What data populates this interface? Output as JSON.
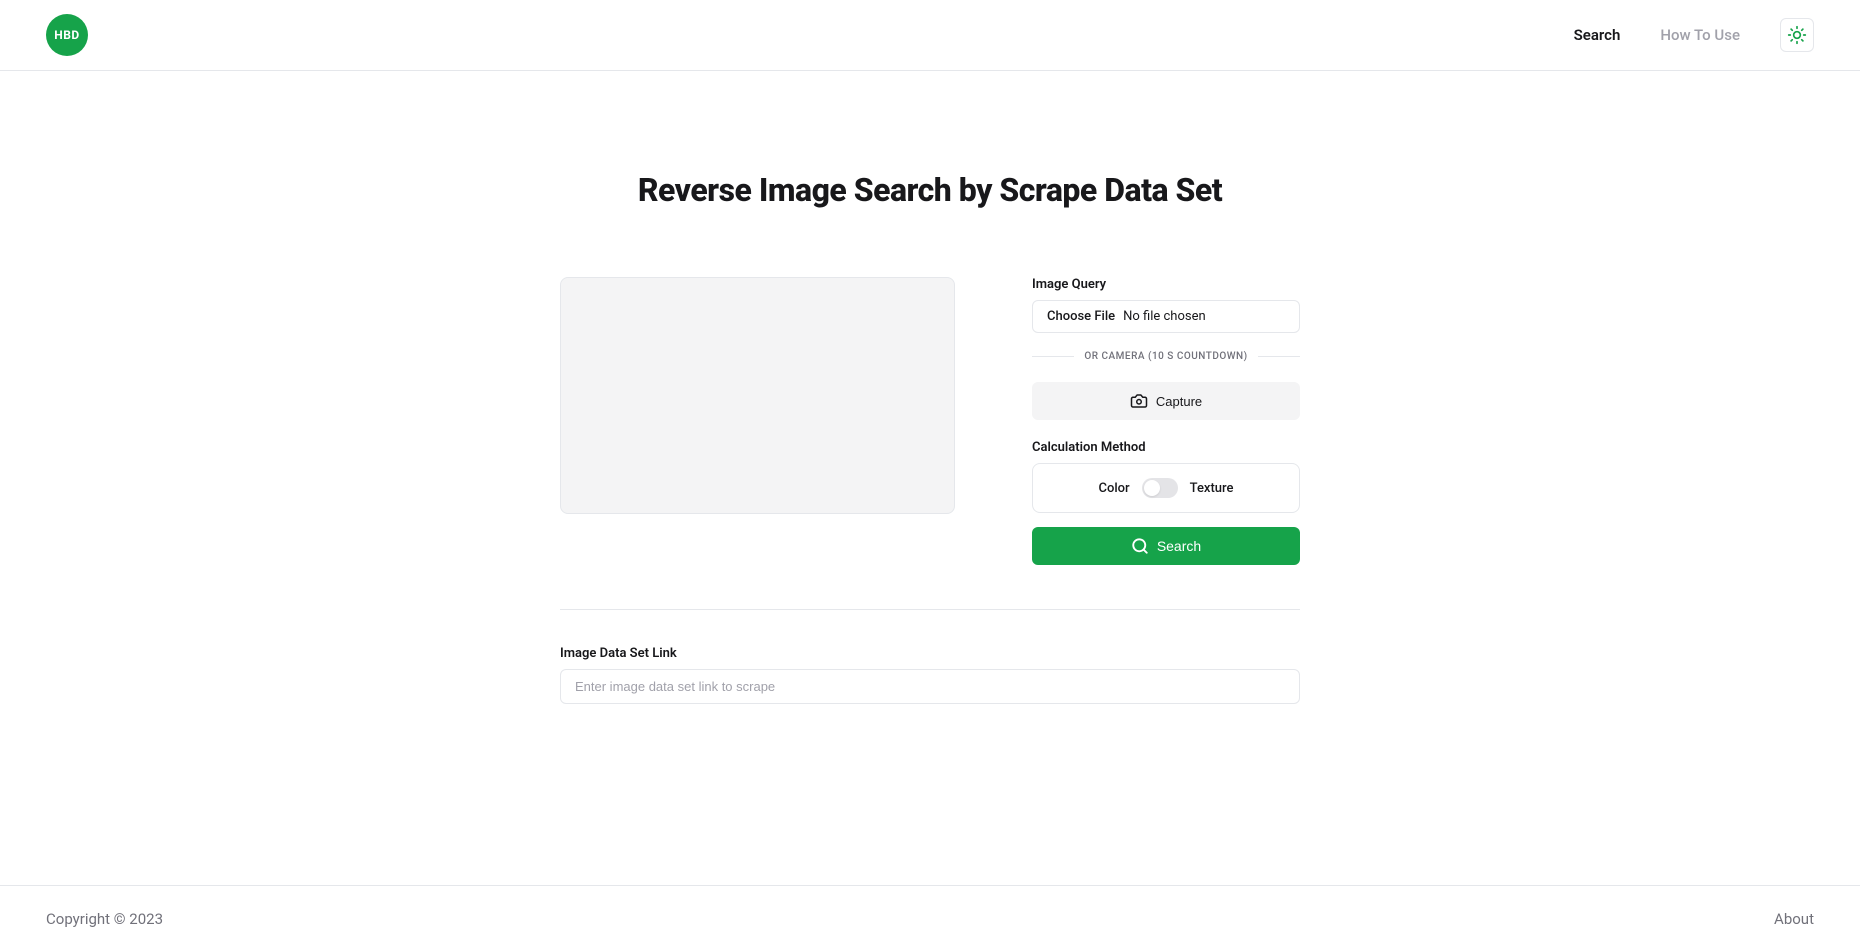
{
  "header": {
    "logo_text": "HBD",
    "nav": {
      "search": "Search",
      "how_to_use": "How To Use"
    }
  },
  "main": {
    "title": "Reverse Image Search by Scrape Data Set",
    "image_query_label": "Image Query",
    "file_input": {
      "choose_label": "Choose File",
      "no_file_label": "No file chosen"
    },
    "camera_divider": "OR CAMERA (10 S COUNTDOWN)",
    "capture_label": "Capture",
    "calc_method_label": "Calculation Method",
    "toggle": {
      "left": "Color",
      "right": "Texture"
    },
    "search_label": "Search",
    "dataset_label": "Image Data Set Link",
    "dataset_placeholder": "Enter image data set link to scrape"
  },
  "footer": {
    "copyright": "Copyright © 2023",
    "about": "About"
  }
}
